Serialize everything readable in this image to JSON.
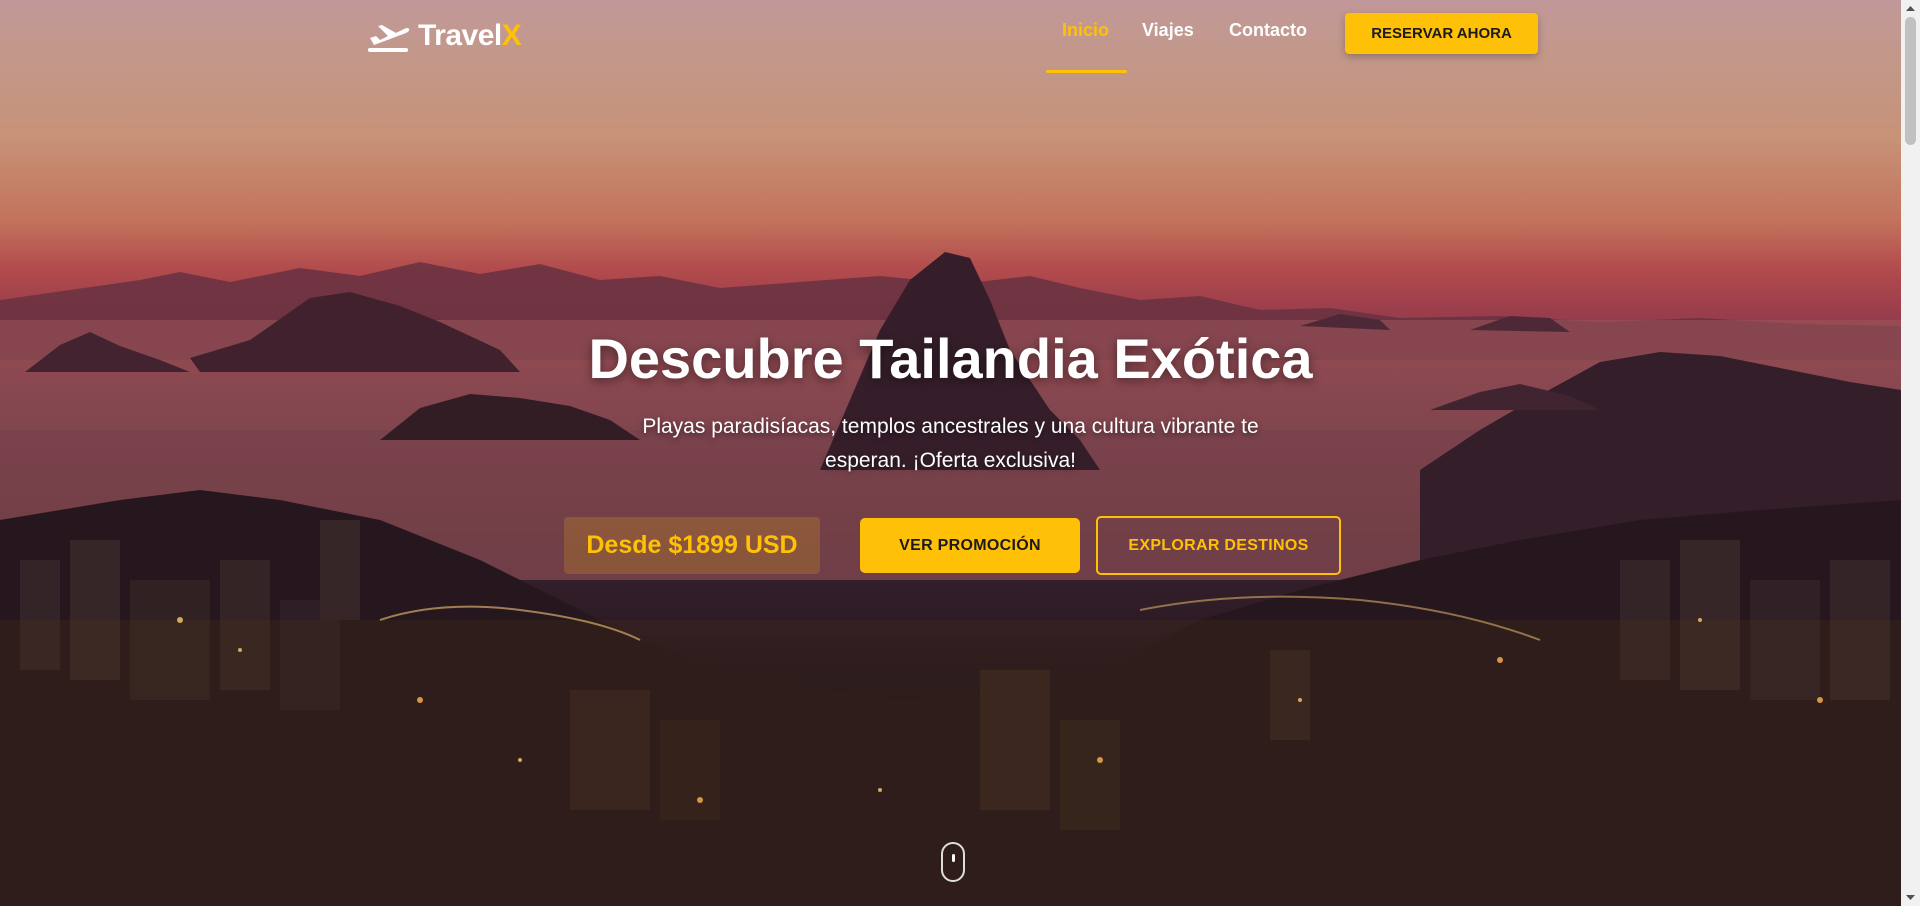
{
  "brand": {
    "name_main": "Travel",
    "name_accent": "X",
    "accent_color": "#ffc107"
  },
  "nav": {
    "items": [
      {
        "label": "Inicio",
        "active": true
      },
      {
        "label": "Viajes",
        "active": false
      },
      {
        "label": "Contacto",
        "active": false
      }
    ],
    "cta_label": "RESERVAR AHORA"
  },
  "hero": {
    "title": "Descubre Tailandia Exótica",
    "subtitle": "Playas paradisíacas, templos ancestrales y una cultura vibrante te esperan. ¡Oferta exclusiva!",
    "price": "Desde $1899 USD",
    "primary_button": "VER PROMOCIÓN",
    "secondary_button": "EXPLORAR DESTINOS"
  },
  "icons": {
    "logo": "airplane-icon",
    "scroll": "mouse-scroll-icon"
  }
}
